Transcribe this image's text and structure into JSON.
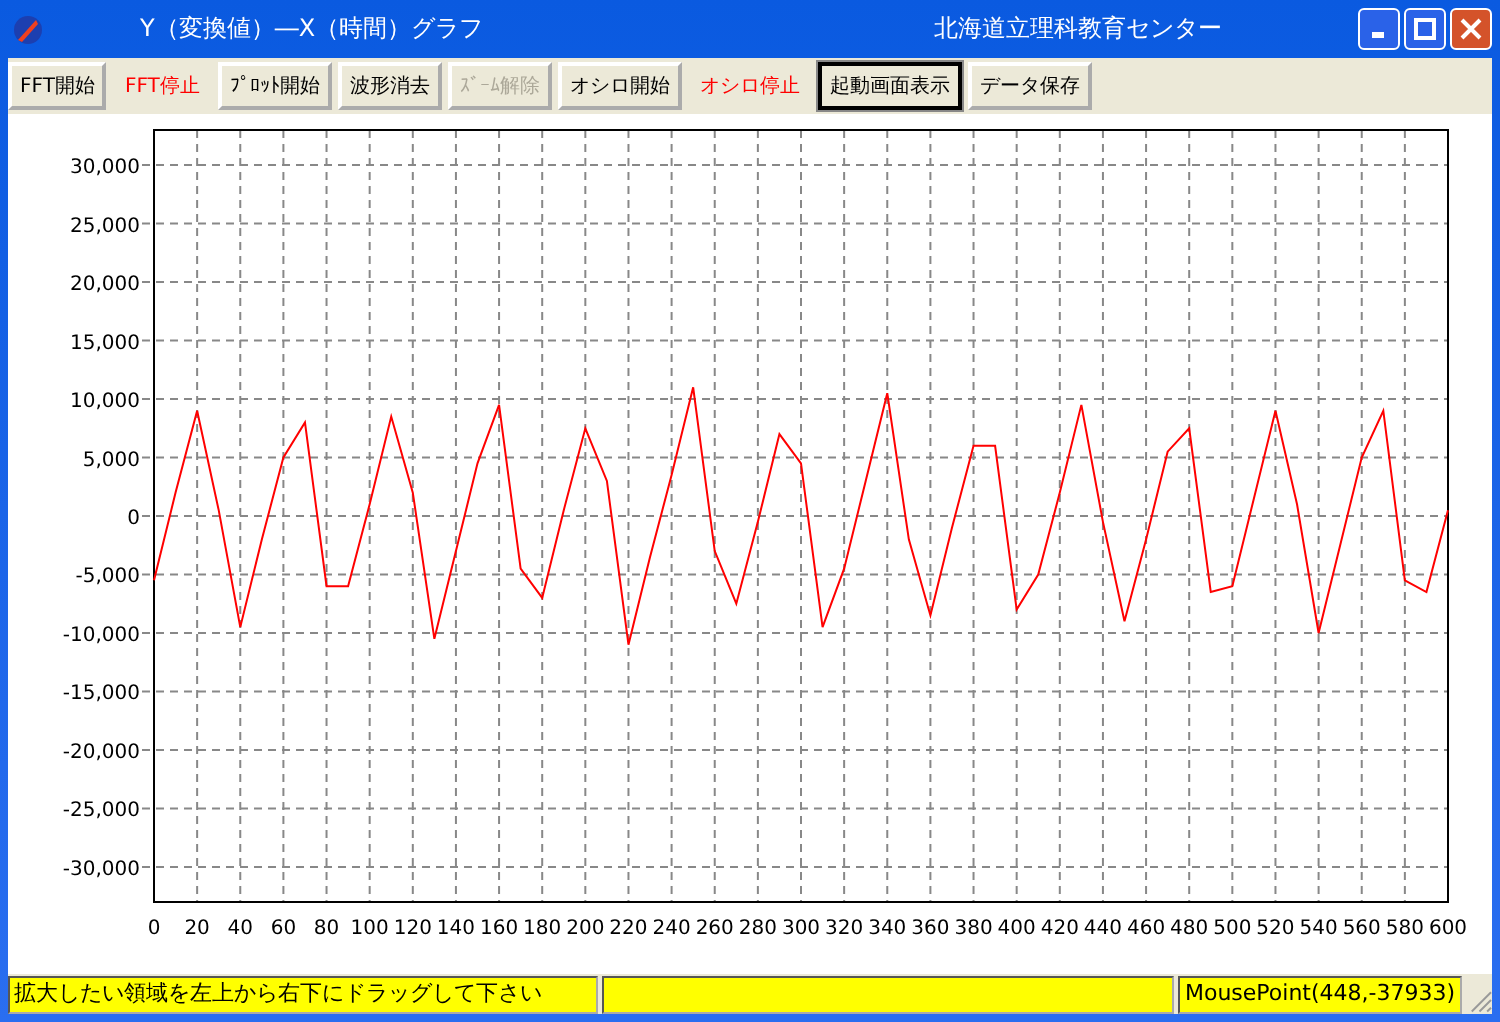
{
  "window": {
    "title": "Y（変換値）―X（時間）グラフ",
    "organization": "北海道立理科教育センター"
  },
  "toolbar": [
    {
      "label": "FFT開始",
      "kind": "normal",
      "disabled": false
    },
    {
      "label": "FFT停止",
      "kind": "stop",
      "disabled": false
    },
    {
      "label": "ﾌﾟﾛｯﾄ開始",
      "kind": "normal",
      "disabled": false
    },
    {
      "label": "波形消去",
      "kind": "normal",
      "disabled": false
    },
    {
      "label": "ｽﾞｰﾑ解除",
      "kind": "normal",
      "disabled": true
    },
    {
      "label": "オシロ開始",
      "kind": "normal",
      "disabled": false
    },
    {
      "label": "オシロ停止",
      "kind": "stop",
      "disabled": false
    },
    {
      "label": "起動画面表示",
      "kind": "focused",
      "disabled": false
    },
    {
      "label": "データ保存",
      "kind": "normal",
      "disabled": false
    }
  ],
  "chart": {
    "chart_data": {
      "type": "line",
      "x": [
        0,
        10,
        20,
        30,
        40,
        50,
        60,
        70,
        80,
        90,
        100,
        110,
        120,
        130,
        140,
        150,
        160,
        170,
        180,
        190,
        200,
        210,
        220,
        230,
        240,
        250,
        260,
        270,
        280,
        290,
        300,
        310,
        320,
        330,
        340,
        350,
        360,
        370,
        380,
        390,
        400,
        410,
        420,
        430,
        440,
        450,
        460,
        470,
        480,
        490,
        500,
        510,
        520,
        530,
        540,
        550,
        560,
        570,
        580,
        590,
        600
      ],
      "series": [
        {
          "color": "#ff0000",
          "values": [
            -5500,
            2000,
            9000,
            500,
            -9500,
            -2000,
            5000,
            8000,
            -6000,
            -6000,
            1000,
            8500,
            2000,
            -10500,
            -3000,
            4500,
            9500,
            -4500,
            -7000,
            500,
            7500,
            3000,
            -11000,
            -3500,
            3500,
            11000,
            -3000,
            -7500,
            -500,
            7000,
            4500,
            -9500,
            -4500,
            3000,
            10500,
            -2000,
            -8500,
            -1000,
            6000,
            6000,
            -8000,
            -5000,
            2000,
            9500,
            -500,
            -9000,
            -2000,
            5500,
            7500,
            -6500,
            -6000,
            1500,
            9000,
            1000,
            -10000,
            -2500,
            5000,
            9000,
            -5500,
            -6500,
            500
          ]
        }
      ],
      "grid": true,
      "xlim": [
        0,
        600
      ],
      "ylim": [
        -33000,
        33000
      ],
      "xticks": [
        0,
        20,
        40,
        60,
        80,
        100,
        120,
        140,
        160,
        180,
        200,
        220,
        240,
        260,
        280,
        300,
        320,
        340,
        360,
        380,
        400,
        420,
        440,
        460,
        480,
        500,
        520,
        540,
        560,
        580,
        600
      ],
      "yticks": [
        {
          "value": 30000,
          "label": "30,000"
        },
        {
          "value": 25000,
          "label": "25,000"
        },
        {
          "value": 20000,
          "label": "20,000"
        },
        {
          "value": 15000,
          "label": "15,000"
        },
        {
          "value": 10000,
          "label": "10,000"
        },
        {
          "value": 5000,
          "label": "5,000"
        },
        {
          "value": 0,
          "label": "0"
        },
        {
          "value": -5000,
          "label": "-5,000"
        },
        {
          "value": -10000,
          "label": "-10,000"
        },
        {
          "value": -15000,
          "label": "-15,000"
        },
        {
          "value": -20000,
          "label": "-20,000"
        },
        {
          "value": -25000,
          "label": "-25,000"
        },
        {
          "value": -30000,
          "label": "-30,000"
        }
      ]
    }
  },
  "status_bar": {
    "message": "拡大したい領域を左上から右下にドラッグして下さい",
    "mouse_point": "MousePoint(448,-37933)"
  }
}
